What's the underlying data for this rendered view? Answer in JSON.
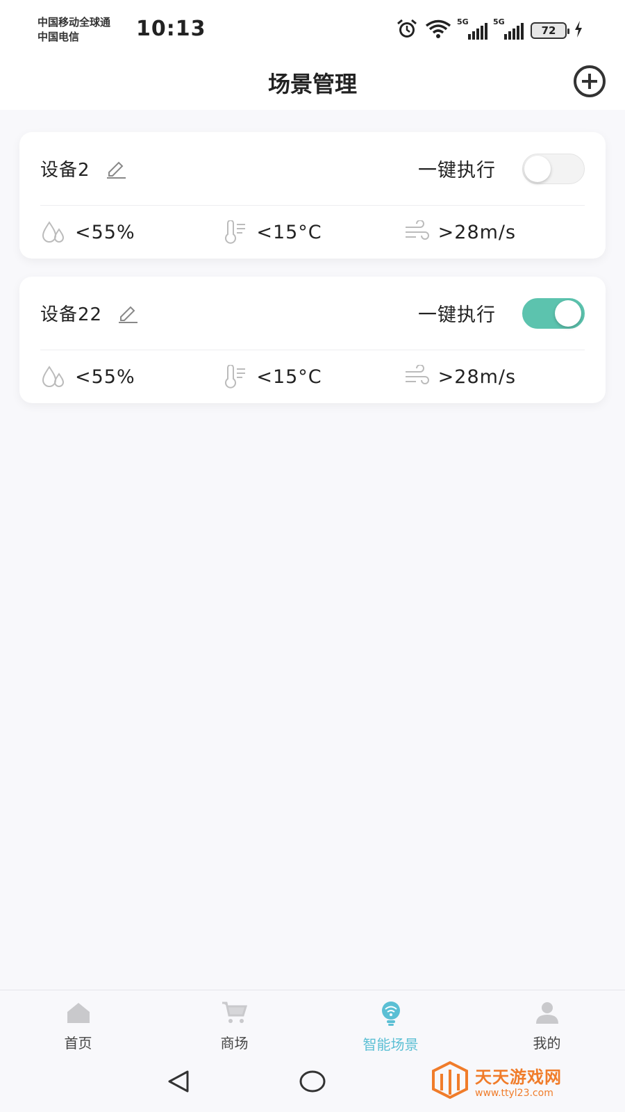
{
  "status_bar": {
    "carrier_1": "中国移动全球通",
    "carrier_2": "中国电信",
    "time": "10:13",
    "signal_1_tag": "5G",
    "signal_2_tag": "5G",
    "battery": "72",
    "icons": [
      "alarm-icon",
      "wifi-icon",
      "signal-icon",
      "signal-icon",
      "battery-icon",
      "charging-icon"
    ]
  },
  "header": {
    "title": "场景管理",
    "add_icon": "plus-circle-icon"
  },
  "scenes": [
    {
      "name": "设备2",
      "exec_label": "一键执行",
      "enabled": false,
      "humidity": "<55%",
      "temperature": "<15°C",
      "wind": ">28m/s"
    },
    {
      "name": "设备22",
      "exec_label": "一键执行",
      "enabled": true,
      "humidity": "<55%",
      "temperature": "<15°C",
      "wind": ">28m/s"
    }
  ],
  "bottom_nav": {
    "items": [
      {
        "label": "首页",
        "icon": "home-icon"
      },
      {
        "label": "商场",
        "icon": "cart-icon"
      },
      {
        "label": "智能场景",
        "icon": "smart-scene-icon"
      },
      {
        "label": "我的",
        "icon": "user-icon"
      }
    ],
    "active_index": 2
  },
  "watermark": {
    "title": "天天游戏网",
    "url": "www.ttyl23.com"
  },
  "colors": {
    "accent": "#5bbfd4",
    "toggle_on": "#5cc3ae",
    "background": "#f8f8fb"
  }
}
